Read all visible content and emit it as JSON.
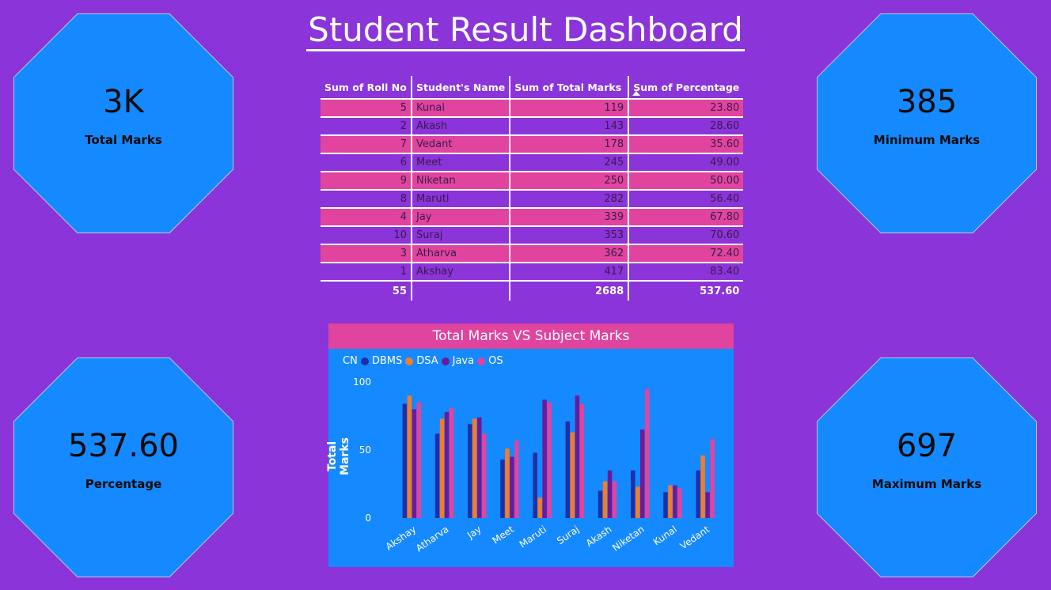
{
  "title": "Student Result Dashboard",
  "kpis": {
    "total": {
      "value": "3K",
      "label": "Total Marks"
    },
    "percentage": {
      "value": "537.60",
      "label": "Percentage"
    },
    "minimum": {
      "value": "385",
      "label": "Minimum Marks"
    },
    "maximum": {
      "value": "697",
      "label": "Maximum Marks"
    }
  },
  "table": {
    "headers": [
      "Sum of Roll No",
      "Student's Name",
      "Sum of Total Marks",
      "Sum of Percentage"
    ],
    "rows": [
      [
        "5",
        "Kunal",
        "119",
        "23.80"
      ],
      [
        "2",
        "Akash",
        "143",
        "28.60"
      ],
      [
        "7",
        "Vedant",
        "178",
        "35.60"
      ],
      [
        "6",
        "Meet",
        "245",
        "49.00"
      ],
      [
        "9",
        "Niketan",
        "250",
        "50.00"
      ],
      [
        "8",
        "Maruti",
        "282",
        "56.40"
      ],
      [
        "4",
        "Jay",
        "339",
        "67.80"
      ],
      [
        "10",
        "Suraj",
        "353",
        "70.60"
      ],
      [
        "3",
        "Atharva",
        "362",
        "72.40"
      ],
      [
        "1",
        "Akshay",
        "417",
        "83.40"
      ]
    ],
    "totals": [
      "55",
      "",
      "2688",
      "537.60"
    ]
  },
  "colors": {
    "background": "#8A34D9",
    "kpi": "#1589FF",
    "accent_pink": "#E0449E",
    "dbms": "#1E2FA8",
    "dsa": "#F07D2C",
    "java": "#6A1B9A",
    "os": "#E0449E"
  },
  "chart_data": {
    "type": "bar",
    "title": "Total Marks VS Subject Marks",
    "ylabel": "Total Marks",
    "xlabel": "",
    "ylim": [
      0,
      100
    ],
    "yticks": [
      0,
      50,
      100
    ],
    "legend_prefix": "CN",
    "categories": [
      "Akshay",
      "Atharva",
      "Jay",
      "Meet",
      "Maruti",
      "Suraj",
      "Akash",
      "Niketan",
      "Kunal",
      "Vedant"
    ],
    "series": [
      {
        "name": "DBMS",
        "color": "#1E2FA8",
        "values": [
          84,
          62,
          69,
          43,
          48,
          71,
          20,
          35,
          19,
          35
        ]
      },
      {
        "name": "DSA",
        "color": "#F07D2C",
        "values": [
          90,
          73,
          73,
          51,
          15,
          63,
          27,
          23,
          24,
          46
        ]
      },
      {
        "name": "Java",
        "color": "#6A1B9A",
        "values": [
          80,
          78,
          74,
          45,
          87,
          90,
          35,
          65,
          24,
          19
        ]
      },
      {
        "name": "OS",
        "color": "#E0449E",
        "values": [
          85,
          81,
          62,
          57,
          85,
          84,
          27,
          95,
          22,
          58
        ]
      }
    ]
  }
}
